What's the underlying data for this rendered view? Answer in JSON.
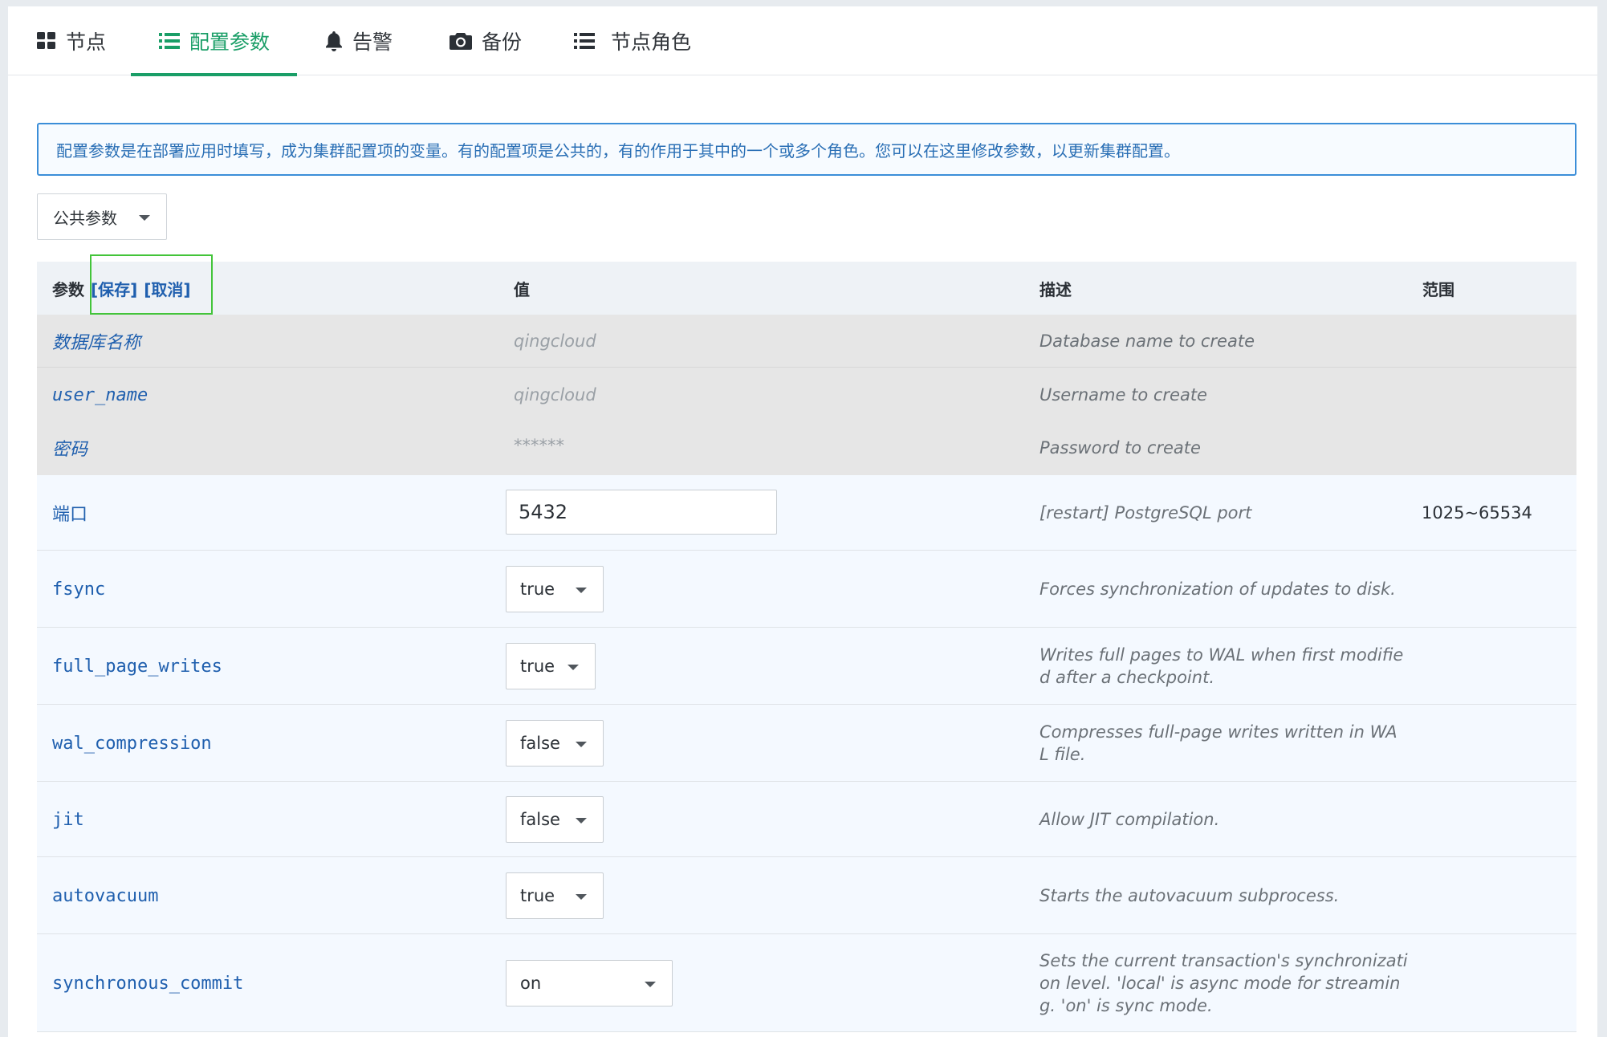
{
  "tabs": [
    {
      "label": "节点",
      "icon": "grid-icon"
    },
    {
      "label": "配置参数",
      "icon": "list-icon"
    },
    {
      "label": "告警",
      "icon": "bell-icon"
    },
    {
      "label": "备份",
      "icon": "camera-icon"
    },
    {
      "label": "节点角色",
      "icon": "list-icon"
    }
  ],
  "active_tab": "配置参数",
  "info_text": "配置参数是在部署应用时填写，成为集群配置项的变量。有的配置项是公共的，有的作用于其中的一个或多个角色。您可以在这里修改参数，以更新集群配置。",
  "scope_select": "公共参数",
  "table": {
    "headers": {
      "param": "参数",
      "save": "[保存]",
      "cancel": "[取消]",
      "value": "值",
      "desc": "描述",
      "range": "范围"
    },
    "readonly_rows": [
      {
        "name": "数据库名称",
        "value": "qingcloud",
        "desc": "Database name to create"
      },
      {
        "name": "user_name",
        "value": "qingcloud",
        "desc": "Username to create"
      },
      {
        "name": "密码",
        "value": "******",
        "desc": "Password to create"
      }
    ],
    "port_row": {
      "name": "端口",
      "value": "5432",
      "desc": "[restart] PostgreSQL port",
      "range": "1025~65534"
    },
    "rows": [
      {
        "name": "fsync",
        "value": "true",
        "desc_lines": [
          "Forces synchronization of updates to disk."
        ]
      },
      {
        "name": "full_page_writes",
        "value": "true",
        "desc_lines": [
          "Writes full pages to WAL when first modifie",
          "d after a checkpoint."
        ]
      },
      {
        "name": "wal_compression",
        "value": "false",
        "desc_lines": [
          "Compresses full-page writes written in WA",
          "L file."
        ]
      },
      {
        "name": "jit",
        "value": "false",
        "desc_lines": [
          "Allow JIT compilation."
        ]
      },
      {
        "name": "autovacuum",
        "value": "true",
        "desc_lines": [
          "Starts the autovacuum subprocess."
        ]
      },
      {
        "name": "synchronous_commit",
        "value": "on",
        "desc_lines": [
          "Sets the current transaction's synchronizati",
          "on level. 'local' is async mode for streamin",
          "g. 'on' is sync mode."
        ]
      }
    ]
  },
  "colors": {
    "accent": "#1a9e67",
    "link": "#1f5fae",
    "info_border": "#3b8ed8",
    "focus": "#43c43a"
  }
}
